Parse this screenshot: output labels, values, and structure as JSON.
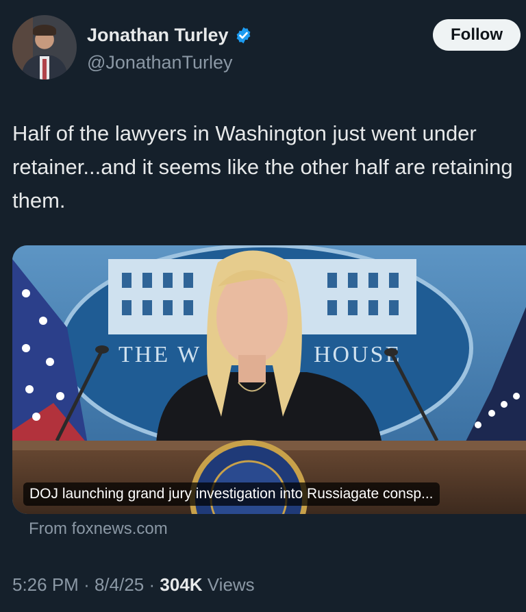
{
  "author": {
    "name": "Jonathan Turley",
    "handle": "@JonathanTurley",
    "verified_icon": "verified-badge-icon",
    "verified_color": "#1d9bf0"
  },
  "follow_label": "Follow",
  "tweet_text": "Half of the lawyers in Washington just went under retainer...and it seems like the other half are retaining them.",
  "card": {
    "headline": "DOJ launching grand jury investigation into Russiagate consp...",
    "seal_text": "THE WHITE HOUSE",
    "source": "From foxnews.com"
  },
  "meta": {
    "time": "5:26 PM",
    "date": "8/4/25",
    "separator": "·",
    "views_count": "304K",
    "views_label": "Views"
  },
  "colors": {
    "background": "#15202b",
    "primary_text": "#e7e9ea",
    "secondary_text": "#8b98a5",
    "follow_bg": "#eff3f4"
  }
}
